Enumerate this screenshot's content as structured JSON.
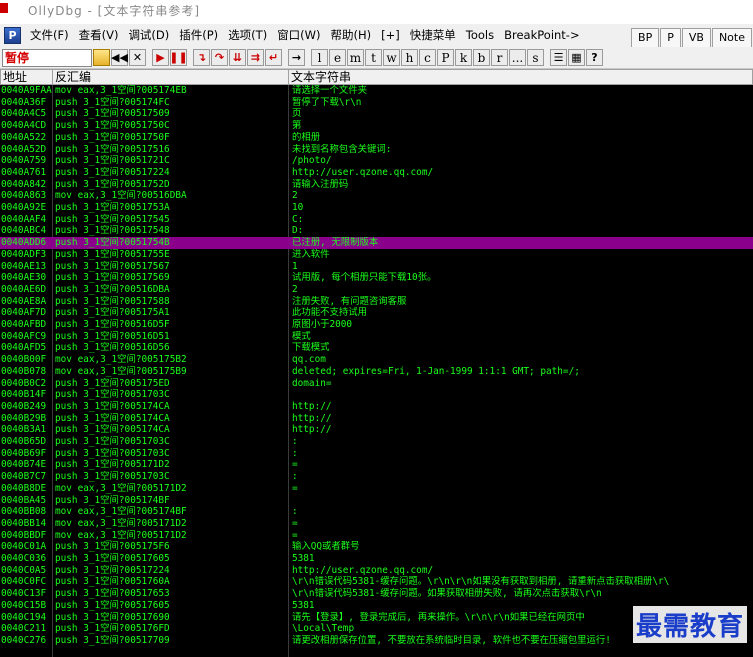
{
  "window": {
    "title_fragment": "OllyDbg - [文本字符串参考]"
  },
  "menu": {
    "items": [
      "文件(F)",
      "查看(V)",
      "调试(D)",
      "插件(P)",
      "选项(T)",
      "窗口(W)",
      "帮助(H)",
      "[+]",
      "快捷菜单",
      "Tools",
      "BreakPoint->"
    ],
    "tabs": [
      "BP",
      "P",
      "VB",
      "Note"
    ]
  },
  "toolbar": {
    "status": "暂停",
    "letters": [
      "l",
      "e",
      "m",
      "t",
      "w",
      "h",
      "c",
      "P",
      "k",
      "b",
      "r",
      "...",
      "s"
    ]
  },
  "columns": {
    "address": "地址",
    "disasm": "反汇编",
    "text": "文本字符串"
  },
  "rows": [
    {
      "addr": "0040A9FAA",
      "disasm": "mov eax,3_1空间?005174EB",
      "text": "请选择一个文件夹"
    },
    {
      "addr": "0040A36F",
      "disasm": "push 3_1空间?005174FC",
      "text": "暂停了下载\\r\\n"
    },
    {
      "addr": "0040A4C5",
      "disasm": "push 3_1空间?00517509",
      "text": "页"
    },
    {
      "addr": "0040A4CD",
      "disasm": "push 3_1空间?0051750C",
      "text": "第"
    },
    {
      "addr": "0040A522",
      "disasm": "push 3_1空间?0051750F",
      "text": "的相册"
    },
    {
      "addr": "0040A52D",
      "disasm": "push 3_1空间?00517516",
      "text": "未找到名称包含关键词:"
    },
    {
      "addr": "0040A759",
      "disasm": "push 3_1空间?0051721C",
      "text": "/photo/"
    },
    {
      "addr": "0040A761",
      "disasm": "push 3_1空间?00517224",
      "text": "http://user.qzone.qq.com/"
    },
    {
      "addr": "0040A842",
      "disasm": "push 3_1空间?0051752D",
      "text": "请输入注册码"
    },
    {
      "addr": "0040A863",
      "disasm": "mov eax,3_1空间?00516DBA",
      "text": "2"
    },
    {
      "addr": "0040A92E",
      "disasm": "push 3_1空间?0051753A",
      "text": "10"
    },
    {
      "addr": "0040AAF4",
      "disasm": "push 3_1空间?00517545",
      "text": "C:"
    },
    {
      "addr": "0040ABC4",
      "disasm": "push 3_1空间?00517548",
      "text": "D:"
    },
    {
      "addr": "0040ADD6",
      "disasm": "push 3_1空间?0051754B",
      "text": "已注册, 无限制版本",
      "selected": true
    },
    {
      "addr": "0040ADF3",
      "disasm": "push 3_1空间?0051755E",
      "text": "进入软件"
    },
    {
      "addr": "0040AE13",
      "disasm": "push 3_1空间?00517567",
      "text": "1"
    },
    {
      "addr": "0040AE30",
      "disasm": "push 3_1空间?00517569",
      "text": "试用版, 每个相册只能下载10张。"
    },
    {
      "addr": "0040AE6D",
      "disasm": "push 3_1空间?00516DBA",
      "text": "2"
    },
    {
      "addr": "0040AE8A",
      "disasm": "push 3_1空间?00517588",
      "text": "注册失败, 有问题咨询客服"
    },
    {
      "addr": "0040AF7D",
      "disasm": "push 3_1空间?005175A1",
      "text": "此功能不支持试用"
    },
    {
      "addr": "0040AFBD",
      "disasm": "push 3_1空间?00516D5F",
      "text": "原图小于2000"
    },
    {
      "addr": "0040AFC9",
      "disasm": "push 3_1空间?00516D51",
      "text": "模式"
    },
    {
      "addr": "0040AFD5",
      "disasm": "push 3_1空间?00516D56",
      "text": "下载模式"
    },
    {
      "addr": "0040B00F",
      "disasm": "mov eax,3_1空间?005175B2",
      "text": "qq.com"
    },
    {
      "addr": "0040B078",
      "disasm": "mov eax,3_1空间?005175B9",
      "text": "deleted; expires=Fri, 1-Jan-1999 1:1:1 GMT; path=/;"
    },
    {
      "addr": "0040B0C2",
      "disasm": "push 3_1空间?005175ED",
      "text": " domain="
    },
    {
      "addr": "0040B14F",
      "disasm": "push 3_1空间?0051703C",
      "text": ""
    },
    {
      "addr": "0040B249",
      "disasm": "push 3_1空间?005174CA",
      "text": "http://"
    },
    {
      "addr": "0040B29B",
      "disasm": "push 3_1空间?005174CA",
      "text": "http://"
    },
    {
      "addr": "0040B3A1",
      "disasm": "push 3_1空间?005174CA",
      "text": "http://"
    },
    {
      "addr": "0040B65D",
      "disasm": "push 3_1空间?0051703C",
      "text": ":"
    },
    {
      "addr": "0040B69F",
      "disasm": "push 3_1空间?0051703C",
      "text": ":"
    },
    {
      "addr": "0040B74E",
      "disasm": "push 3_1空间?005171D2",
      "text": "="
    },
    {
      "addr": "0040B7C7",
      "disasm": "push 3_1空间?0051703C",
      "text": ":"
    },
    {
      "addr": "0040B8DE",
      "disasm": "mov eax,3_1空间?005171D2",
      "text": "="
    },
    {
      "addr": "0040BA45",
      "disasm": "push 3_1空间?005174BF",
      "text": ""
    },
    {
      "addr": "0040BB08",
      "disasm": "mov eax,3_1空间?005174BF",
      "text": ":"
    },
    {
      "addr": "0040BB14",
      "disasm": "mov eax,3_1空间?005171D2",
      "text": "="
    },
    {
      "addr": "0040BBDF",
      "disasm": "mov eax,3_1空间?005171D2",
      "text": "="
    },
    {
      "addr": "0040C01A",
      "disasm": "push 3_1空间?005175F6",
      "text": "输入QQ或者群号"
    },
    {
      "addr": "0040C036",
      "disasm": "push 3_1空间?00517605",
      "text": "5381"
    },
    {
      "addr": "0040C0A5",
      "disasm": "push 3_1空间?00517224",
      "text": "http://user.qzone.qq.com/"
    },
    {
      "addr": "0040C0FC",
      "disasm": "push 3_1空间?0051760A",
      "text": "\\r\\n错误代码5381-缓存问题。\\r\\n\\r\\n如果没有获取到相册, 请重新点击获取相册\\r\\"
    },
    {
      "addr": "0040C13F",
      "disasm": "push 3_1空间?00517653",
      "text": "\\r\\n错误代码5381-缓存问题。如果获取相册失败, 请再次点击获取\\r\\n"
    },
    {
      "addr": "0040C15B",
      "disasm": "push 3_1空间?00517605",
      "text": "5381"
    },
    {
      "addr": "0040C194",
      "disasm": "push 3_1空间?00517690",
      "text": "请先【登录】, 登录完成后, 再来操作。\\r\\n\\r\\n如果已经在网页中"
    },
    {
      "addr": "0040C211",
      "disasm": "push 3_1空间?005176FD",
      "text": "\\Local\\Temp"
    },
    {
      "addr": "0040C276",
      "disasm": "push 3_1空间?00517709",
      "text": "请更改相册保存位置, 不要放在系统临时目录, 软件也不要在压缩包里运行!"
    }
  ],
  "watermark": "最需教育"
}
